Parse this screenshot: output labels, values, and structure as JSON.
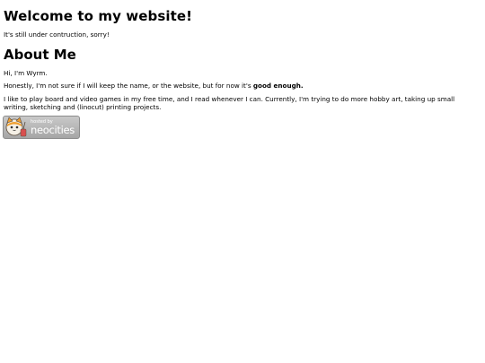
{
  "header": {
    "title": "Welcome to my website!",
    "subtitle": "It's still under contruction, sorry!"
  },
  "about": {
    "heading": "About Me",
    "greeting": "Hi, I'm Wyrm.",
    "honesty_prefix": "Honestly, I'm not sure if I will keep the name, or the website, but for now it's ",
    "honesty_bold": "good enough.",
    "hobbies": "I like to play board and video games in my free time, and I read whenever I can. Currently, I'm trying to do more hobby art, taking up small writing, sketching and (linocut) printing projects."
  },
  "badge": {
    "small_text": "hosted by",
    "big_text": "neocities",
    "icon": "neocities-cat-icon"
  }
}
